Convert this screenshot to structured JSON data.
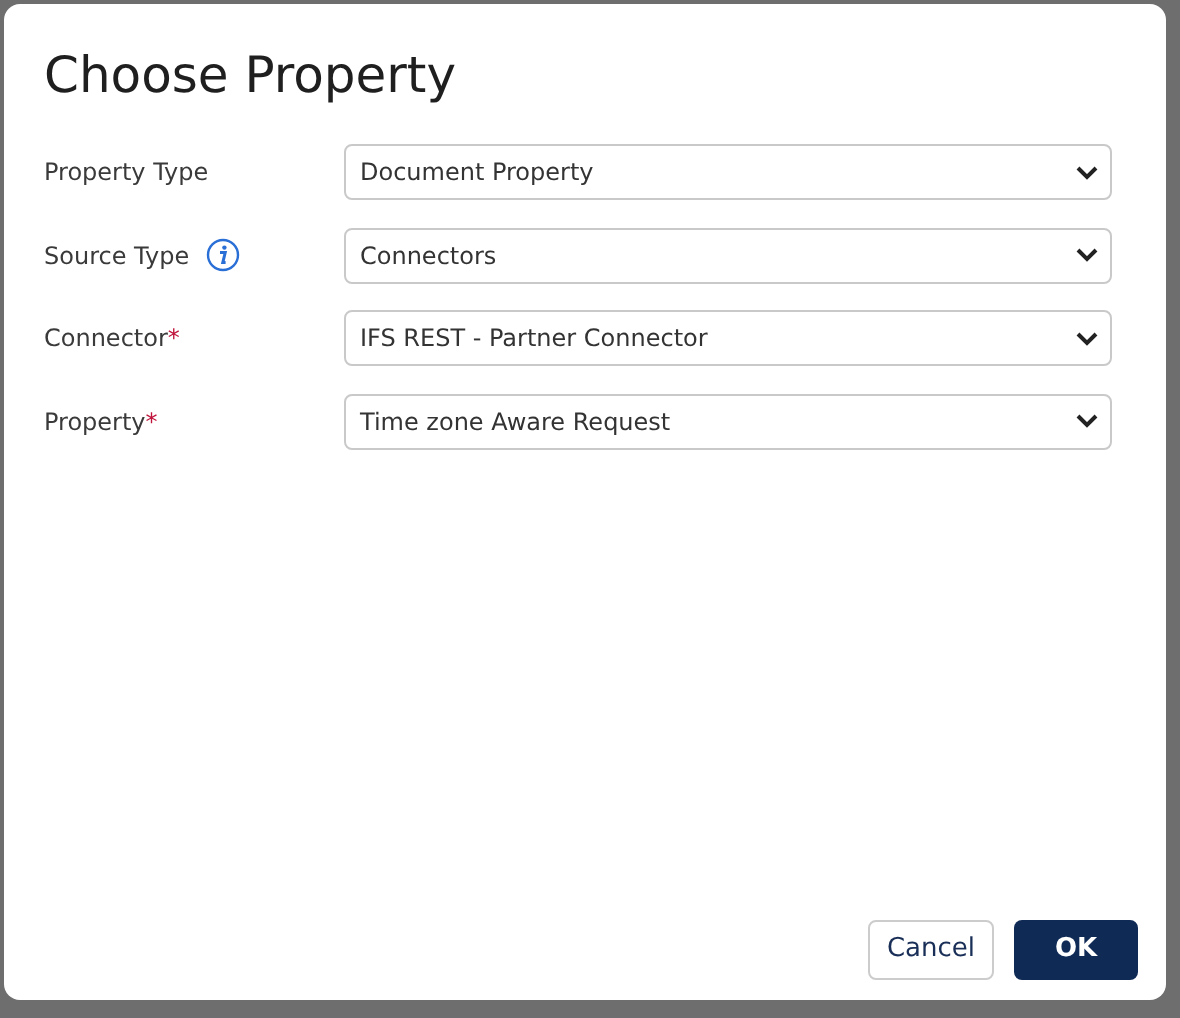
{
  "dialog": {
    "title": "Choose Property",
    "fields": [
      {
        "label": "Property Type",
        "info": false,
        "value": "Document Property"
      },
      {
        "label": "Source Type",
        "info": true,
        "value": "Connectors"
      },
      {
        "label": "Connector",
        "required_mark": "*",
        "info": false,
        "value": "IFS REST - Partner Connector"
      },
      {
        "label": "Property",
        "required_mark": "*",
        "info": false,
        "value": "Time zone Aware Request"
      }
    ],
    "buttons": [
      {
        "label": "Cancel",
        "kind": "secondary"
      },
      {
        "label": "OK",
        "kind": "primary"
      }
    ]
  }
}
